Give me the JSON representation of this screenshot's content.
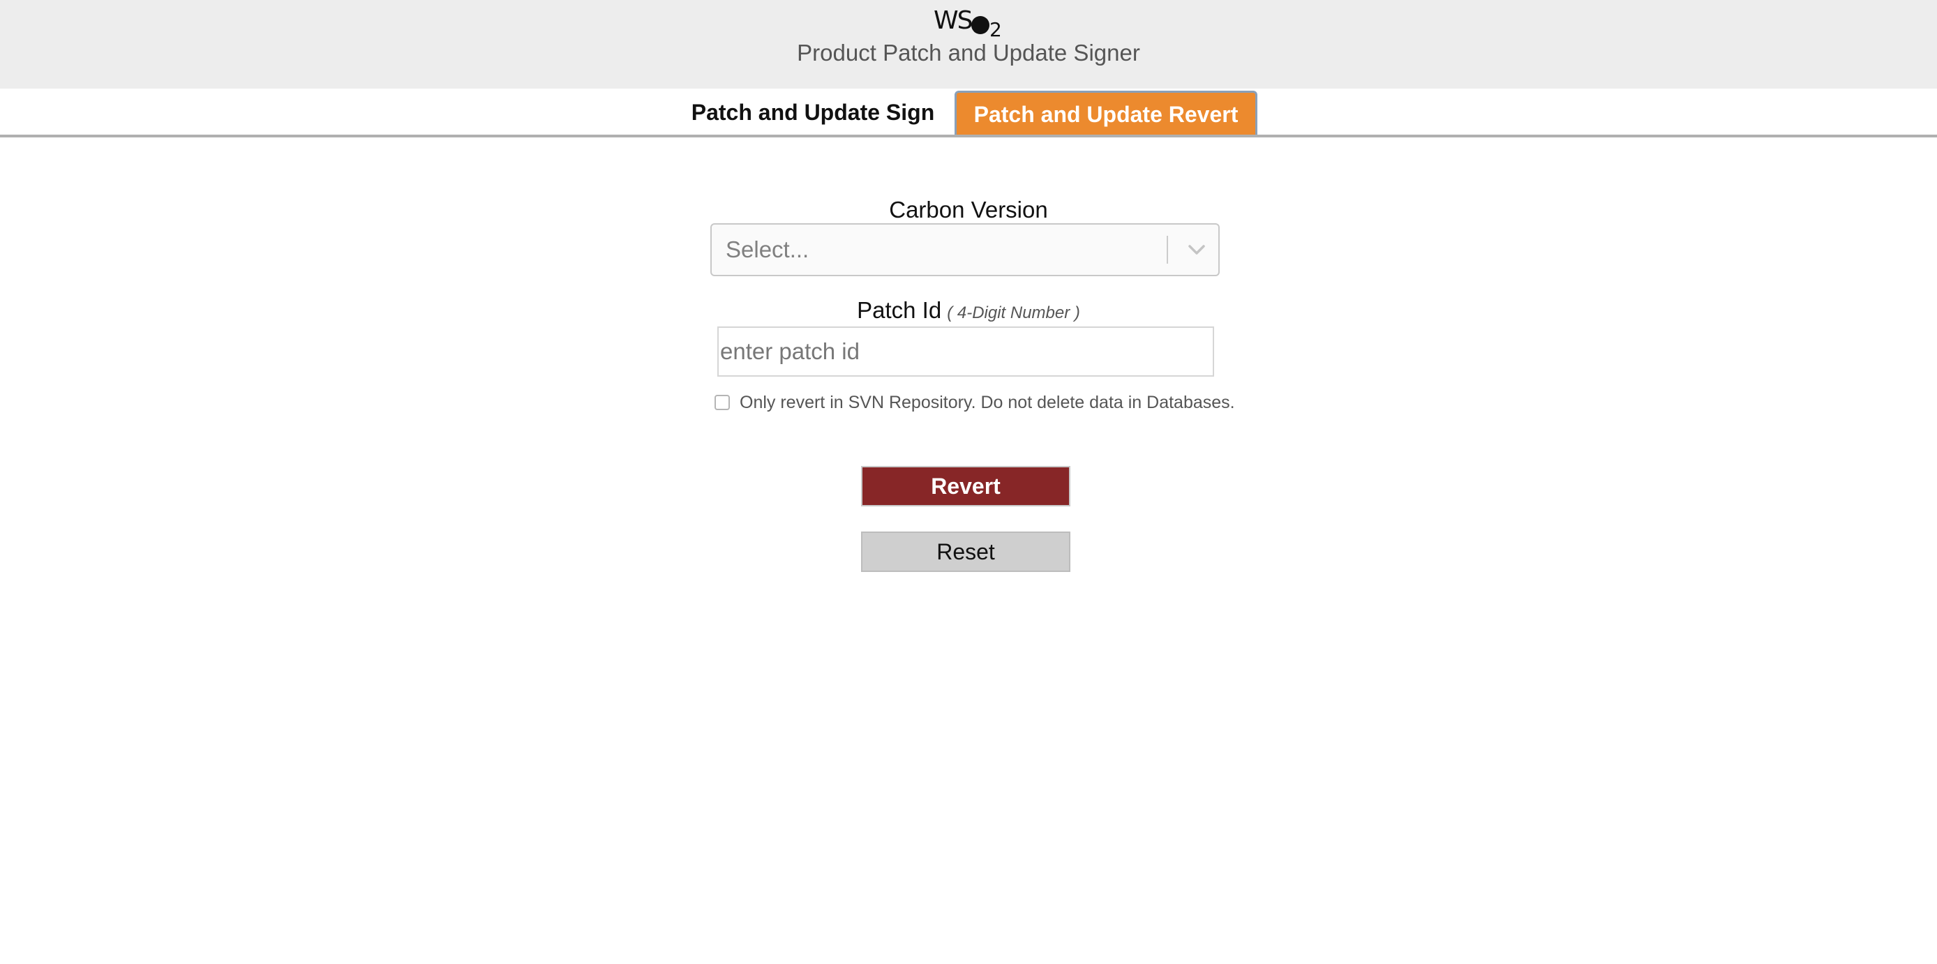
{
  "header": {
    "logo_text": "WSO2",
    "title": "Product Patch and Update Signer"
  },
  "tabs": [
    {
      "label": "Patch and Update Sign",
      "active": false
    },
    {
      "label": "Patch and Update Revert",
      "active": true
    }
  ],
  "form": {
    "carbon_version": {
      "label": "Carbon Version",
      "placeholder": "Select...",
      "icon": "chevron-down-icon"
    },
    "patch_id": {
      "label": "Patch Id",
      "hint": "( 4-Digit Number )",
      "placeholder": "enter patch id",
      "value": ""
    },
    "svn_only": {
      "label": "Only revert in SVN Repository. Do not delete data in Databases.",
      "checked": false
    },
    "revert_button": "Revert",
    "reset_button": "Reset"
  },
  "colors": {
    "header_bg": "#ededed",
    "active_tab": "#ec8a2e",
    "revert_button": "#872627",
    "reset_button": "#cfcfcf"
  }
}
